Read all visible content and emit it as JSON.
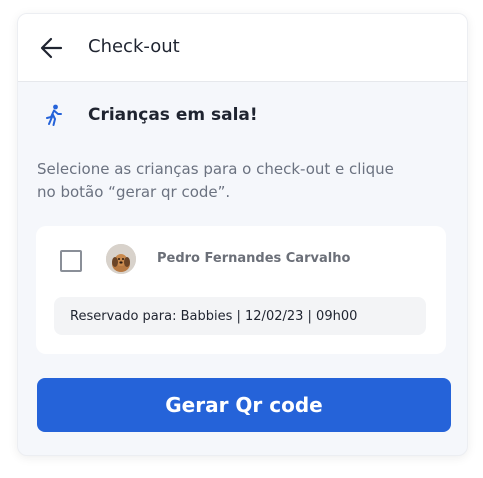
{
  "header": {
    "title": "Check-out",
    "back_icon": "arrow-left-icon"
  },
  "section": {
    "icon": "walking-person-icon",
    "title": "Crianças em sala!",
    "accent": "#2563d9"
  },
  "description": "Selecione as crianças para o check-out e clique no botão “gerar qr code”.",
  "children": [
    {
      "checked": false,
      "avatar_icon": "child-avatar",
      "name": "Pedro Fernandes Carvalho",
      "reservation": "Reservado para: Babbies | 12/02/23 | 09h00"
    }
  ],
  "cta": {
    "label": "Gerar Qr code",
    "color": "#2563d9"
  }
}
